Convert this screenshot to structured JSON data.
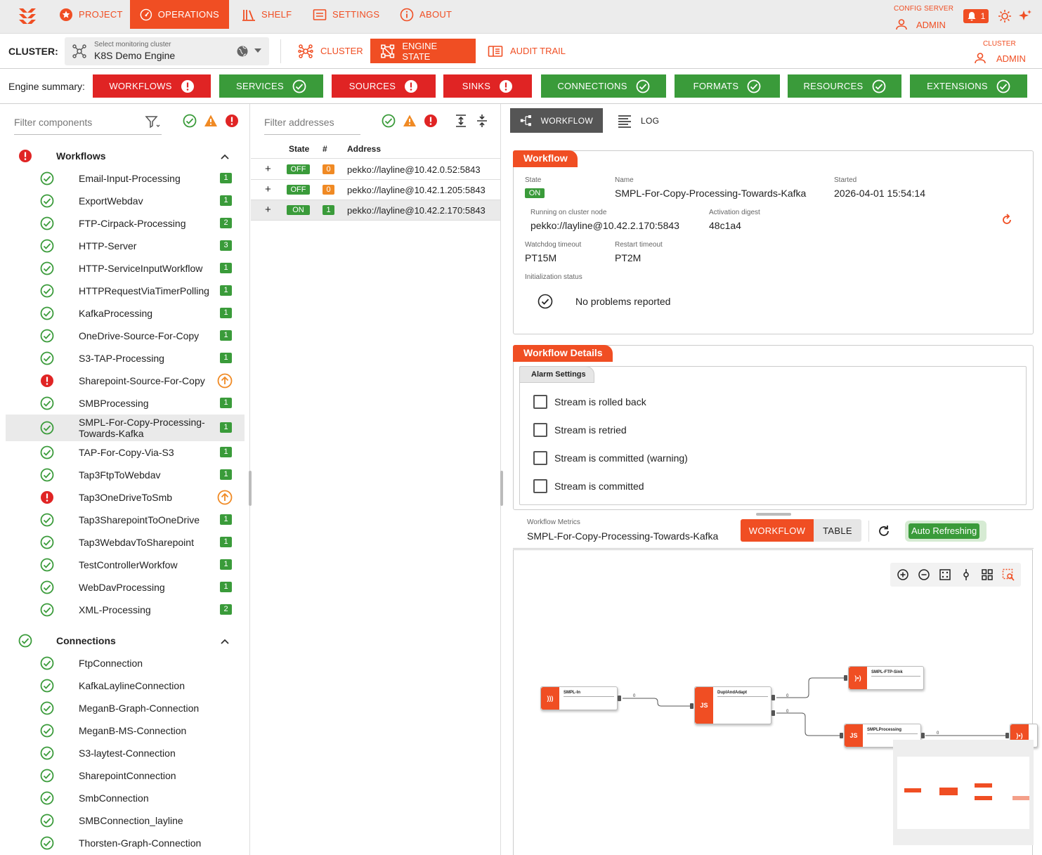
{
  "nav": {
    "items": [
      {
        "label": "PROJECT",
        "icon": "star-badge-icon"
      },
      {
        "label": "OPERATIONS",
        "icon": "speedometer-icon",
        "active": true
      },
      {
        "label": "SHELF",
        "icon": "books-icon"
      },
      {
        "label": "SETTINGS",
        "icon": "settings-list-icon"
      },
      {
        "label": "ABOUT",
        "icon": "info-icon"
      }
    ],
    "config_server_label": "CONFIG SERVER",
    "config_admin": "ADMIN",
    "notification_count": "1"
  },
  "cluster": {
    "label": "CLUSTER:",
    "select_hint": "Select monitoring cluster",
    "select_value": "K8S Demo Engine",
    "tabs": [
      {
        "label": "CLUSTER",
        "icon": "cluster-icon"
      },
      {
        "label": "ENGINE STATE",
        "icon": "engine-state-icon",
        "active": true
      },
      {
        "label": "AUDIT TRAIL",
        "icon": "audit-trail-icon"
      }
    ],
    "right_label": "CLUSTER",
    "right_admin": "ADMIN"
  },
  "summary": {
    "label": "Engine summary:",
    "items": [
      {
        "label": "WORKFLOWS",
        "status": "error"
      },
      {
        "label": "SERVICES",
        "status": "ok"
      },
      {
        "label": "SOURCES",
        "status": "error"
      },
      {
        "label": "SINKS",
        "status": "error"
      },
      {
        "label": "CONNECTIONS",
        "status": "ok"
      },
      {
        "label": "FORMATS",
        "status": "ok"
      },
      {
        "label": "RESOURCES",
        "status": "ok"
      },
      {
        "label": "EXTENSIONS",
        "status": "ok"
      }
    ],
    "colors": {
      "error": "#e02424",
      "ok": "#3a9b3a",
      "accent": "#f04e23",
      "warning": "#f08a24"
    }
  },
  "components": {
    "filter_placeholder": "Filter components",
    "workflows": {
      "title": "Workflows",
      "items": [
        {
          "name": "Email-Input-Processing",
          "status": "ok",
          "count": "1"
        },
        {
          "name": "ExportWebdav",
          "status": "ok",
          "count": "1"
        },
        {
          "name": "FTP-Cirpack-Processing",
          "status": "ok",
          "count": "2"
        },
        {
          "name": "HTTP-Server",
          "status": "ok",
          "count": "3"
        },
        {
          "name": "HTTP-ServiceInputWorkflow",
          "status": "ok",
          "count": "1"
        },
        {
          "name": "HTTPRequestViaTimerPolling",
          "status": "ok",
          "count": "1"
        },
        {
          "name": "KafkaProcessing",
          "status": "ok",
          "count": "1"
        },
        {
          "name": "OneDrive-Source-For-Copy",
          "status": "ok",
          "count": "1"
        },
        {
          "name": "S3-TAP-Processing",
          "status": "ok",
          "count": "1"
        },
        {
          "name": "Sharepoint-Source-For-Copy",
          "status": "error",
          "count": ""
        },
        {
          "name": "SMBProcessing",
          "status": "ok",
          "count": "1"
        },
        {
          "name": "SMPL-For-Copy-Processing-Towards-Kafka",
          "line1": "SMPL-For-Copy-Processing-",
          "line2": "Towards-Kafka",
          "status": "ok",
          "count": "1",
          "selected": true
        },
        {
          "name": "TAP-For-Copy-Via-S3",
          "status": "ok",
          "count": "1"
        },
        {
          "name": "Tap3FtpToWebdav",
          "status": "ok",
          "count": "1"
        },
        {
          "name": "Tap3OneDriveToSmb",
          "status": "error",
          "count": ""
        },
        {
          "name": "Tap3SharepointToOneDrive",
          "status": "ok",
          "count": "1"
        },
        {
          "name": "Tap3WebdavToSharepoint",
          "status": "ok",
          "count": "1"
        },
        {
          "name": "TestControllerWorkfow",
          "status": "ok",
          "count": "1"
        },
        {
          "name": "WebDavProcessing",
          "status": "ok",
          "count": "1"
        },
        {
          "name": "XML-Processing",
          "status": "ok",
          "count": "2"
        }
      ]
    },
    "connections": {
      "title": "Connections",
      "items": [
        {
          "name": "FtpConnection"
        },
        {
          "name": "KafkaLaylineConnection"
        },
        {
          "name": "MeganB-Graph-Connection"
        },
        {
          "name": "MeganB-MS-Connection"
        },
        {
          "name": "S3-laytest-Connection"
        },
        {
          "name": "SharepointConnection"
        },
        {
          "name": "SmbConnection"
        },
        {
          "name": "SMBConnection_layline"
        },
        {
          "name": "Thorsten-Graph-Connection"
        }
      ]
    }
  },
  "addresses": {
    "filter_placeholder": "Filter addresses",
    "columns": [
      "State",
      "#",
      "Address"
    ],
    "rows": [
      {
        "state": "OFF",
        "count": "0",
        "address": "pekko://layline@10.42.0.52:5843"
      },
      {
        "state": "OFF",
        "count": "0",
        "address": "pekko://layline@10.42.1.205:5843"
      },
      {
        "state": "ON",
        "count": "1",
        "address": "pekko://layline@10.42.2.170:5843",
        "selected": true
      }
    ]
  },
  "detail": {
    "tabs": [
      {
        "label": "WORKFLOW",
        "icon": "workflow-graph-icon"
      },
      {
        "label": "LOG",
        "icon": "log-lines-icon"
      }
    ],
    "workflow_card": {
      "title": "Workflow",
      "state_label": "State",
      "state_value": "ON",
      "name_label": "Name",
      "name_value": "SMPL-For-Copy-Processing-Towards-Kafka",
      "started_label": "Started",
      "started_value": "2026-04-01 15:54:14",
      "node_label": "Running on cluster node",
      "node_value": "pekko://layline@10.42.2.170:5843",
      "digest_label": "Activation digest",
      "digest_value": "48c1a4",
      "watchdog_label": "Watchdog timeout",
      "watchdog_value": "PT15M",
      "restart_label": "Restart timeout",
      "restart_value": "PT2M",
      "init_label": "Initialization status",
      "init_value": "No problems reported"
    },
    "details_card": {
      "title": "Workflow Details",
      "alarm_tab": "Alarm Settings",
      "alarms": [
        "Stream is rolled back",
        "Stream is retried",
        "Stream is committed (warning)",
        "Stream is committed"
      ]
    },
    "metrics": {
      "label": "Workflow Metrics",
      "value": "SMPL-For-Copy-Processing-Towards-Kafka",
      "seg_workflow": "WORKFLOW",
      "seg_table": "TABLE",
      "auto": "Auto Refreshing"
    },
    "graph": {
      "nodes": [
        {
          "name": "SMPL-In",
          "icon": "stream-source-icon"
        },
        {
          "name": "DuplAndAdapt",
          "icon": "JS"
        },
        {
          "name": "SMPL-FTP-Sink",
          "icon": "stream-sink-icon"
        },
        {
          "name": "SMPLProcessing",
          "icon": "JS"
        }
      ],
      "port_label": "0"
    }
  }
}
